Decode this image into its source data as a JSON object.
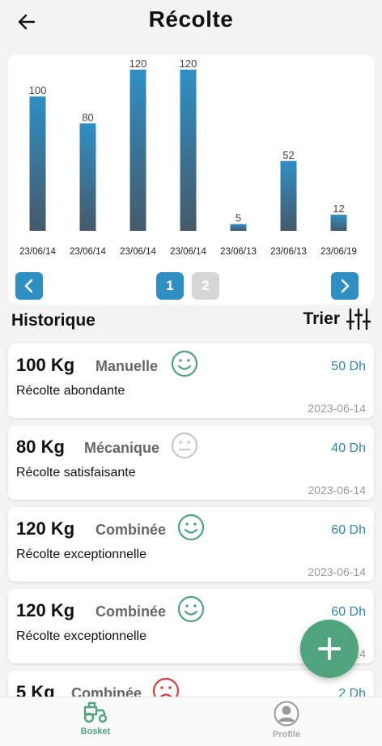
{
  "header": {
    "title": "Récolte",
    "back_icon": "arrow-left-icon"
  },
  "chart_data": {
    "type": "bar",
    "categories": [
      "23/06/14",
      "23/06/14",
      "23/06/14",
      "23/06/14",
      "23/06/13",
      "23/06/13",
      "23/06/19"
    ],
    "values": [
      100,
      80,
      120,
      120,
      5,
      52,
      12
    ],
    "ylim": [
      0,
      120
    ],
    "grid": false,
    "colors": {
      "bar_top": "#2e8fc4",
      "bar_bottom": "#46596a",
      "label": "#444444"
    }
  },
  "pagination": {
    "pages": [
      "1",
      "2"
    ],
    "current": "1",
    "prev_icon": "chevron-left-icon",
    "next_icon": "chevron-right-icon"
  },
  "section": {
    "title": "Historique",
    "sort_label": "Trier",
    "sort_icon": "sliders-icon"
  },
  "records": [
    {
      "quantity": "100 Kg",
      "method": "Manuelle",
      "mood": "happy",
      "price": "50 Dh",
      "description": "Récolte abondante",
      "date": "2023-06-14"
    },
    {
      "quantity": "80 Kg",
      "method": "Mécanique",
      "mood": "neutral",
      "price": "40 Dh",
      "description": "Récolte satisfaisante",
      "date": "2023-06-14"
    },
    {
      "quantity": "120 Kg",
      "method": "Combinée",
      "mood": "happy",
      "price": "60 Dh",
      "description": "Récolte exceptionnelle",
      "date": "2023-06-14"
    },
    {
      "quantity": "120 Kg",
      "method": "Combinée",
      "mood": "happy",
      "price": "60 Dh",
      "description": "Récolte exceptionnelle",
      "date": "2023-06-14"
    },
    {
      "quantity": "5 Kg",
      "method": "Combinée",
      "mood": "sad",
      "price": "2 Dh",
      "description": "",
      "date": ""
    }
  ],
  "fab": {
    "icon": "plus-icon"
  },
  "bottom_nav": [
    {
      "label": "Bosket",
      "icon": "tractor-icon",
      "active": true
    },
    {
      "label": "Profile",
      "icon": "user-icon",
      "active": false
    }
  ],
  "colors": {
    "accent": "#2f8fc3",
    "green": "#4fa37d",
    "sad": "#e0393e",
    "neutral": "#c8c8c8",
    "price": "#2f86b3"
  }
}
